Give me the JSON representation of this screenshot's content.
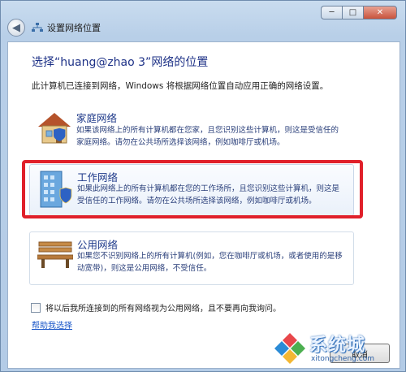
{
  "window": {
    "title": "设置网络位置",
    "controls": {
      "minimize": "─",
      "maximize": "□",
      "close": "✕"
    }
  },
  "main": {
    "heading": "选择“huang@zhao  3”网络的位置",
    "intro": "此计算机已连接到网络，Windows 将根据网络位置自动应用正确的网络设置。",
    "options": [
      {
        "id": "home",
        "title": "家庭网络",
        "description": "如果该网络上的所有计算机都在您家，且您识别这些计算机，则这是受信任的家庭网络。请勿在公共场所选择该网络，例如咖啡厅或机场。",
        "icon": "house-icon"
      },
      {
        "id": "work",
        "title": "工作网络",
        "description": "如果此网络上的所有计算机都在您的工作场所，且您识别这些计算机，则这是受信任的工作网络。请勿在公共场所选择该网络，例如咖啡厅或机场。",
        "icon": "office-building-icon"
      },
      {
        "id": "public",
        "title": "公用网络",
        "description": "如果您不识别网络上的所有计算机(例如，您在咖啡厅或机场，或者使用的是移动宽带)，则这是公用网络，不受信任。",
        "icon": "park-bench-icon"
      }
    ],
    "checkbox_label": "将以后我所连接到的所有网络视为公用网络，且不要再向我询问。",
    "checkbox_checked": false,
    "help_link": "帮助我选择",
    "cancel_label": "取消"
  },
  "watermark": {
    "brand": "系统城",
    "url": "xitongcheng.com"
  },
  "colors": {
    "highlight": "#e0202a",
    "title_blue": "#1e3287",
    "link": "#1a56c8"
  }
}
